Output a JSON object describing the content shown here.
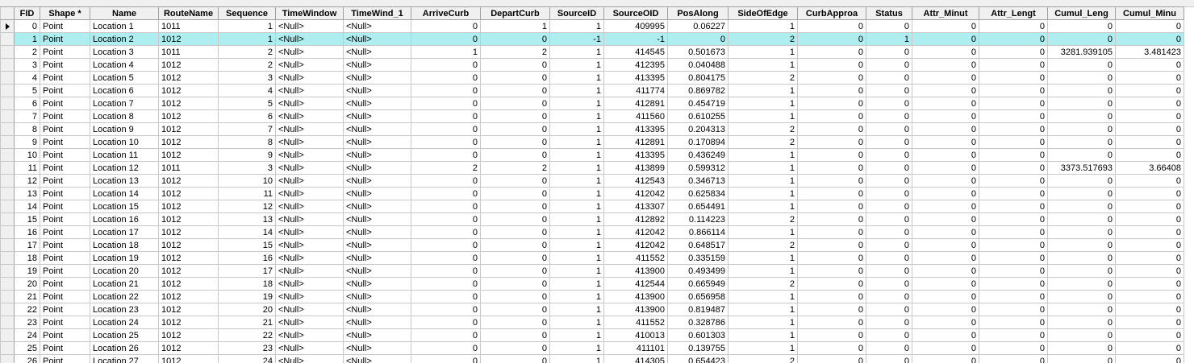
{
  "columns": [
    "FID",
    "Shape *",
    "Name",
    "RouteName",
    "Sequence",
    "TimeWindow",
    "TimeWind_1",
    "ArriveCurb",
    "DepartCurb",
    "SourceID",
    "SourceOID",
    "PosAlong",
    "SideOfEdge",
    "CurbApproa",
    "Status",
    "Attr_Minut",
    "Attr_Lengt",
    "Cumul_Leng",
    "Cumul_Minu"
  ],
  "selected_row_index": 1,
  "current_row_index": 0,
  "rows": [
    [
      "0",
      "Point",
      "Location 1",
      "1011",
      "1",
      "<Null>",
      "<Null>",
      "0",
      "1",
      "1",
      "409995",
      "0.06227",
      "1",
      "0",
      "0",
      "0",
      "0",
      "0",
      "0"
    ],
    [
      "1",
      "Point",
      "Location 2",
      "1012",
      "1",
      "<Null>",
      "<Null>",
      "0",
      "0",
      "-1",
      "-1",
      "0",
      "2",
      "0",
      "1",
      "0",
      "0",
      "0",
      "0"
    ],
    [
      "2",
      "Point",
      "Location 3",
      "1011",
      "2",
      "<Null>",
      "<Null>",
      "1",
      "2",
      "1",
      "414545",
      "0.501673",
      "1",
      "0",
      "0",
      "0",
      "0",
      "3281.939105",
      "3.481423"
    ],
    [
      "3",
      "Point",
      "Location 4",
      "1012",
      "2",
      "<Null>",
      "<Null>",
      "0",
      "0",
      "1",
      "412395",
      "0.040488",
      "1",
      "0",
      "0",
      "0",
      "0",
      "0",
      "0"
    ],
    [
      "4",
      "Point",
      "Location 5",
      "1012",
      "3",
      "<Null>",
      "<Null>",
      "0",
      "0",
      "1",
      "413395",
      "0.804175",
      "2",
      "0",
      "0",
      "0",
      "0",
      "0",
      "0"
    ],
    [
      "5",
      "Point",
      "Location 6",
      "1012",
      "4",
      "<Null>",
      "<Null>",
      "0",
      "0",
      "1",
      "411774",
      "0.869782",
      "1",
      "0",
      "0",
      "0",
      "0",
      "0",
      "0"
    ],
    [
      "6",
      "Point",
      "Location 7",
      "1012",
      "5",
      "<Null>",
      "<Null>",
      "0",
      "0",
      "1",
      "412891",
      "0.454719",
      "1",
      "0",
      "0",
      "0",
      "0",
      "0",
      "0"
    ],
    [
      "7",
      "Point",
      "Location 8",
      "1012",
      "6",
      "<Null>",
      "<Null>",
      "0",
      "0",
      "1",
      "411560",
      "0.610255",
      "1",
      "0",
      "0",
      "0",
      "0",
      "0",
      "0"
    ],
    [
      "8",
      "Point",
      "Location 9",
      "1012",
      "7",
      "<Null>",
      "<Null>",
      "0",
      "0",
      "1",
      "413395",
      "0.204313",
      "2",
      "0",
      "0",
      "0",
      "0",
      "0",
      "0"
    ],
    [
      "9",
      "Point",
      "Location 10",
      "1012",
      "8",
      "<Null>",
      "<Null>",
      "0",
      "0",
      "1",
      "412891",
      "0.170894",
      "2",
      "0",
      "0",
      "0",
      "0",
      "0",
      "0"
    ],
    [
      "10",
      "Point",
      "Location 11",
      "1012",
      "9",
      "<Null>",
      "<Null>",
      "0",
      "0",
      "1",
      "413395",
      "0.436249",
      "1",
      "0",
      "0",
      "0",
      "0",
      "0",
      "0"
    ],
    [
      "11",
      "Point",
      "Location 12",
      "1011",
      "3",
      "<Null>",
      "<Null>",
      "2",
      "2",
      "1",
      "413899",
      "0.599312",
      "1",
      "0",
      "0",
      "0",
      "0",
      "3373.517693",
      "3.66408"
    ],
    [
      "12",
      "Point",
      "Location 13",
      "1012",
      "10",
      "<Null>",
      "<Null>",
      "0",
      "0",
      "1",
      "412543",
      "0.346713",
      "1",
      "0",
      "0",
      "0",
      "0",
      "0",
      "0"
    ],
    [
      "13",
      "Point",
      "Location 14",
      "1012",
      "11",
      "<Null>",
      "<Null>",
      "0",
      "0",
      "1",
      "412042",
      "0.625834",
      "1",
      "0",
      "0",
      "0",
      "0",
      "0",
      "0"
    ],
    [
      "14",
      "Point",
      "Location 15",
      "1012",
      "12",
      "<Null>",
      "<Null>",
      "0",
      "0",
      "1",
      "413307",
      "0.654491",
      "1",
      "0",
      "0",
      "0",
      "0",
      "0",
      "0"
    ],
    [
      "15",
      "Point",
      "Location 16",
      "1012",
      "13",
      "<Null>",
      "<Null>",
      "0",
      "0",
      "1",
      "412892",
      "0.114223",
      "2",
      "0",
      "0",
      "0",
      "0",
      "0",
      "0"
    ],
    [
      "16",
      "Point",
      "Location 17",
      "1012",
      "14",
      "<Null>",
      "<Null>",
      "0",
      "0",
      "1",
      "412042",
      "0.866114",
      "1",
      "0",
      "0",
      "0",
      "0",
      "0",
      "0"
    ],
    [
      "17",
      "Point",
      "Location 18",
      "1012",
      "15",
      "<Null>",
      "<Null>",
      "0",
      "0",
      "1",
      "412042",
      "0.648517",
      "2",
      "0",
      "0",
      "0",
      "0",
      "0",
      "0"
    ],
    [
      "18",
      "Point",
      "Location 19",
      "1012",
      "16",
      "<Null>",
      "<Null>",
      "0",
      "0",
      "1",
      "411552",
      "0.335159",
      "1",
      "0",
      "0",
      "0",
      "0",
      "0",
      "0"
    ],
    [
      "19",
      "Point",
      "Location 20",
      "1012",
      "17",
      "<Null>",
      "<Null>",
      "0",
      "0",
      "1",
      "413900",
      "0.493499",
      "1",
      "0",
      "0",
      "0",
      "0",
      "0",
      "0"
    ],
    [
      "20",
      "Point",
      "Location 21",
      "1012",
      "18",
      "<Null>",
      "<Null>",
      "0",
      "0",
      "1",
      "412544",
      "0.665949",
      "2",
      "0",
      "0",
      "0",
      "0",
      "0",
      "0"
    ],
    [
      "21",
      "Point",
      "Location 22",
      "1012",
      "19",
      "<Null>",
      "<Null>",
      "0",
      "0",
      "1",
      "413900",
      "0.656958",
      "1",
      "0",
      "0",
      "0",
      "0",
      "0",
      "0"
    ],
    [
      "22",
      "Point",
      "Location 23",
      "1012",
      "20",
      "<Null>",
      "<Null>",
      "0",
      "0",
      "1",
      "413900",
      "0.819487",
      "1",
      "0",
      "0",
      "0",
      "0",
      "0",
      "0"
    ],
    [
      "23",
      "Point",
      "Location 24",
      "1012",
      "21",
      "<Null>",
      "<Null>",
      "0",
      "0",
      "1",
      "411552",
      "0.328786",
      "1",
      "0",
      "0",
      "0",
      "0",
      "0",
      "0"
    ],
    [
      "24",
      "Point",
      "Location 25",
      "1012",
      "22",
      "<Null>",
      "<Null>",
      "0",
      "0",
      "1",
      "410013",
      "0.601303",
      "1",
      "0",
      "0",
      "0",
      "0",
      "0",
      "0"
    ],
    [
      "25",
      "Point",
      "Location 26",
      "1012",
      "23",
      "<Null>",
      "<Null>",
      "0",
      "0",
      "1",
      "411101",
      "0.139755",
      "1",
      "0",
      "0",
      "0",
      "0",
      "0",
      "0"
    ],
    [
      "26",
      "Point",
      "Location 27",
      "1012",
      "24",
      "<Null>",
      "<Null>",
      "0",
      "0",
      "1",
      "414305",
      "0.654423",
      "2",
      "0",
      "0",
      "0",
      "0",
      "0",
      "0"
    ]
  ],
  "text_columns": [
    1,
    2,
    3,
    5,
    6
  ],
  "colors": {
    "selected_row": "#aeeef1",
    "header_bg": "#f0f0f0",
    "grid_line": "#c8c8c8"
  }
}
